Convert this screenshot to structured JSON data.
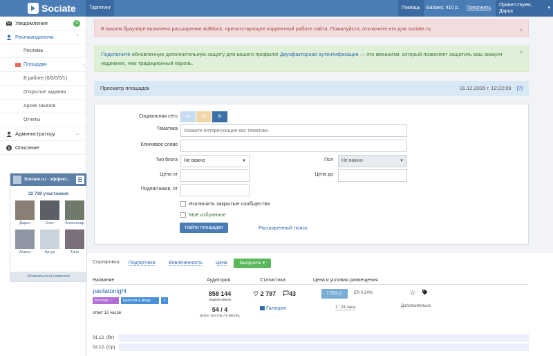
{
  "topbar": {
    "app_name": "Sociate",
    "tab_targeting": "Таргетинг",
    "help": "Помощь",
    "balance": "Баланс: 410 р.",
    "topup": "Пополнить",
    "greeting": "Приветствуем,",
    "user_name": "Дарья"
  },
  "sidebar": {
    "items": [
      {
        "label": "Уведомления",
        "badge": "3"
      },
      {
        "label": "Рекламодателю"
      },
      {
        "label": "Реклама"
      },
      {
        "label": "Площадки"
      },
      {
        "label": "В работе (0/0/0/0/1)"
      },
      {
        "label": "Открытые задания"
      },
      {
        "label": "Архив заказов"
      },
      {
        "label": "Отчеты"
      },
      {
        "label": "Администратору"
      },
      {
        "label": "Описание"
      }
    ]
  },
  "vk_widget": {
    "title": "Sociate.ru - эффект...",
    "vk_letter": "В",
    "members_count": "32 738 участников",
    "members": [
      "Дарья",
      "Олег",
      "Александр",
      "Алина",
      "Артур",
      "Таня"
    ],
    "unsubscribe": "Отписаться от новостей"
  },
  "alerts": {
    "adblock": "В вашем браузере включено расширение AdBlock, препятствующее корректной работе сайта. Пожалуйста, отключите его для sociate.ru.",
    "twofa_link1": "Подключите",
    "twofa_text1": " обновленную дополнительную защиту для вашего профиля! ",
    "twofa_link2": "Двухфакторная аутентификация",
    "twofa_text2": " — это механизм, который позволяет защитить ваш аккаунт надежнее, чем традиционный пароль.",
    "close": "×"
  },
  "section": {
    "title": "Просмотр площадок",
    "datetime": "01.12.2015 г. 12:22:09",
    "help": "[?]"
  },
  "form": {
    "social_label": "Социальная сеть",
    "networks": [
      "вк",
      "ок",
      "fb"
    ],
    "topic_label": "Тематика",
    "topic_placeholder": "Укажите интересующие вас тематики",
    "keyword_label": "Ключевое слово",
    "blog_type_label": "Тип блога",
    "blog_type_value": "Не важно",
    "gender_label": "Пол",
    "gender_value": "Не важно",
    "price_from_label": "Цена от",
    "price_to_label": "Цена до",
    "subs_from_label": "Подписчиков, от",
    "exclude_closed": "Исключить закрытые сообщества",
    "favorites": "Моё избранное",
    "find_button": "Найти площадки",
    "advanced": "Расширенный поиск"
  },
  "results": {
    "sort_label": "Сортировка:",
    "sort_subs": "Подписчики",
    "sort_inv": "Вовлеченность",
    "sort_price": "Цена",
    "export": "Выгрузить ▾",
    "col_name": "Название",
    "col_audience": "Аудитория",
    "col_stats": "Статистика",
    "col_price": "Цена и условия размещения",
    "row": {
      "account": "paolatonight",
      "tag_blogger": "Блоггер ♀",
      "tag_topic": "Красота и мода",
      "tag_plus": "+",
      "answer": "ответ 12 часов",
      "subscribers": "858 144",
      "subscribers_label": "подписчиков",
      "posts": "54 / 4",
      "posts_label": "всего постов / в месяц",
      "likes": "♡ 2 797",
      "comments": "43",
      "gallery": "Галерея",
      "price": "1 553 р.",
      "er": "ER 0,34%",
      "period": "1 / 24 часа",
      "more": "Дополнительно"
    },
    "days": [
      "01.12. (Вт)",
      "02.12. (Ср)"
    ]
  }
}
